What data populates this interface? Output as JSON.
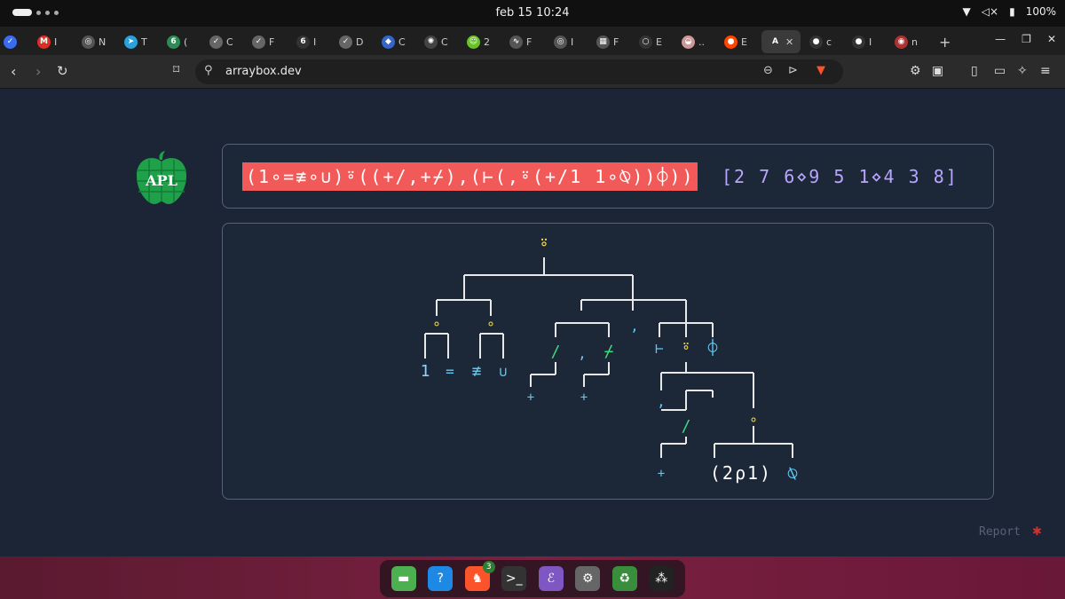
{
  "system": {
    "clock": "feb 15  10:24",
    "battery": "100%"
  },
  "tabs": [
    {
      "icon": "todo-icon",
      "color": "#3b6cf0",
      "glyph": "✓",
      "label": ""
    },
    {
      "icon": "gmail-icon",
      "color": "#d93025",
      "glyph": "M",
      "label": "I"
    },
    {
      "icon": "globe-icon",
      "color": "#555",
      "glyph": "◎",
      "label": "N"
    },
    {
      "icon": "telegram-icon",
      "color": "#2aa1da",
      "glyph": "➤",
      "label": "T"
    },
    {
      "icon": "six-icon",
      "color": "#2e8b57",
      "glyph": "6",
      "label": "("
    },
    {
      "icon": "check-icon",
      "color": "#666",
      "glyph": "✓",
      "label": "C"
    },
    {
      "icon": "check-icon",
      "color": "#666",
      "glyph": "✓",
      "label": "F"
    },
    {
      "icon": "six-icon",
      "color": "#333",
      "glyph": "6",
      "label": "I"
    },
    {
      "icon": "check-icon",
      "color": "#666",
      "glyph": "✓",
      "label": "D"
    },
    {
      "icon": "gem-icon",
      "color": "#3566c8",
      "glyph": "◆",
      "label": "C"
    },
    {
      "icon": "openai-icon",
      "color": "#444",
      "glyph": "✺",
      "label": "C"
    },
    {
      "icon": "smile-icon",
      "color": "#6ac02b",
      "glyph": "☺",
      "label": "2"
    },
    {
      "icon": "chart-icon",
      "color": "#555",
      "glyph": "∿",
      "label": "F"
    },
    {
      "icon": "globe-icon",
      "color": "#555",
      "glyph": "◎",
      "label": "I"
    },
    {
      "icon": "grid-icon",
      "color": "#555",
      "glyph": "▦",
      "label": "F"
    },
    {
      "icon": "circle-icon",
      "color": "#333",
      "glyph": "○",
      "label": "E"
    },
    {
      "icon": "paint-icon",
      "color": "#c99",
      "glyph": "◒",
      "label": ".."
    },
    {
      "icon": "reddit-icon",
      "color": "#ff4500",
      "glyph": "●",
      "label": "E"
    },
    {
      "icon": "arraybox-icon",
      "color": "#3a3a3a",
      "glyph": "A",
      "label": "",
      "active": true
    },
    {
      "icon": "github-icon",
      "color": "#333",
      "glyph": "●",
      "label": "c"
    },
    {
      "icon": "github-icon",
      "color": "#333",
      "glyph": "●",
      "label": "I"
    },
    {
      "icon": "shield-icon",
      "color": "#a33",
      "glyph": "◉",
      "label": "n"
    }
  ],
  "address": {
    "url": "arraybox.dev"
  },
  "page": {
    "logo_text": "APL",
    "expression": "(1∘=≢∘∪)⍤((+/,+⌿),(⊢(,⍤(+/1 1∘⍉))⌽))",
    "argument": "[2 7 6⋄9 5 1⋄4 3 8]",
    "report": "Report",
    "tree_nodes": [
      {
        "glyph": "⍤",
        "color": "#f5d84a"
      },
      {
        "glyph": "∘",
        "color": "#f5d84a"
      },
      {
        "glyph": "∘",
        "color": "#f5d84a"
      },
      {
        "glyph": "1",
        "color": "#8fd3ff"
      },
      {
        "glyph": "=",
        "color": "#5fc8f0"
      },
      {
        "glyph": "≢",
        "color": "#5fc8f0"
      },
      {
        "glyph": "∪",
        "color": "#5fc8f0"
      },
      {
        "glyph": "/",
        "color": "#3ed97a"
      },
      {
        "glyph": ",",
        "color": "#5fc8f0"
      },
      {
        "glyph": "⌿",
        "color": "#3ed97a"
      },
      {
        "glyph": "+",
        "color": "#5fc8f0"
      },
      {
        "glyph": "+",
        "color": "#5fc8f0"
      },
      {
        "glyph": ",",
        "color": "#5fc8f0"
      },
      {
        "glyph": "⊢",
        "color": "#5fc8f0"
      },
      {
        "glyph": "⍤",
        "color": "#f5d84a"
      },
      {
        "glyph": "⌽",
        "color": "#5fc8f0"
      },
      {
        "glyph": ",",
        "color": "#5fc8f0"
      },
      {
        "glyph": "/",
        "color": "#3ed97a"
      },
      {
        "glyph": "∘",
        "color": "#f5d84a"
      },
      {
        "glyph": "+",
        "color": "#5fc8f0"
      },
      {
        "glyph": "(2⍴1)",
        "color": "#ffffff"
      },
      {
        "glyph": "⍉",
        "color": "#5fc8f0"
      }
    ]
  },
  "dock": [
    {
      "icon": "files-icon",
      "color": "#4caf50",
      "glyph": "▬"
    },
    {
      "icon": "help-icon",
      "color": "#1e88e5",
      "glyph": "?"
    },
    {
      "icon": "brave-icon",
      "color": "#fb542b",
      "glyph": "♞",
      "badge": "3"
    },
    {
      "icon": "terminal-icon",
      "color": "#333333",
      "glyph": ">_"
    },
    {
      "icon": "emacs-icon",
      "color": "#7e57c2",
      "glyph": "ℰ"
    },
    {
      "icon": "settings-icon",
      "color": "#666666",
      "glyph": "⚙"
    },
    {
      "icon": "trash-icon",
      "color": "#388e3c",
      "glyph": "♻"
    },
    {
      "icon": "apps-icon",
      "color": "#222222",
      "glyph": "⁂"
    }
  ]
}
